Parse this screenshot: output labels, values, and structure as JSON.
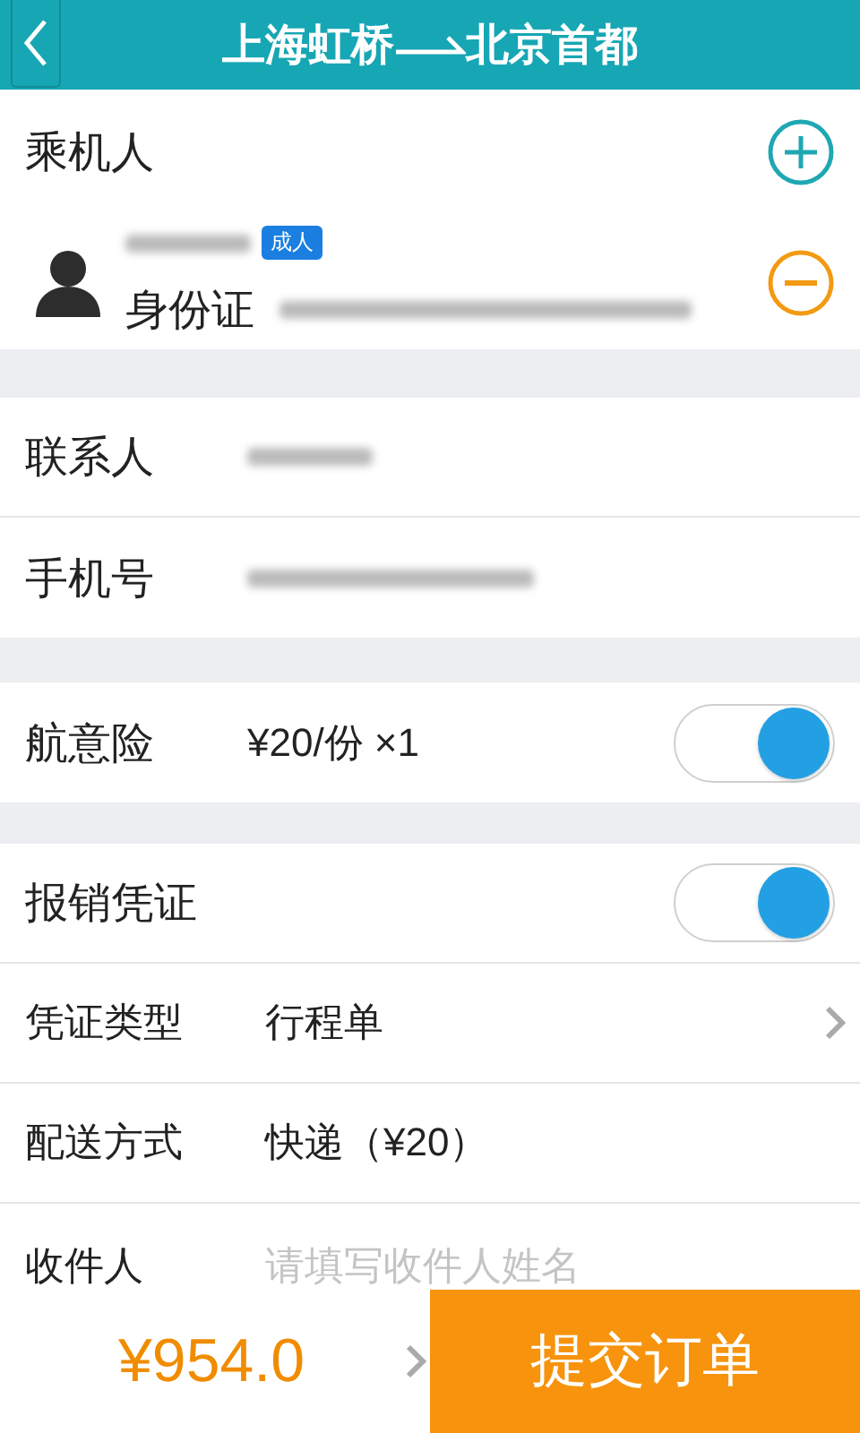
{
  "header": {
    "origin": "上海虹桥",
    "destination": "北京首都"
  },
  "passengers": {
    "title": "乘机人",
    "items": [
      {
        "type_badge": "成人",
        "id_label": "身份证"
      }
    ]
  },
  "contact": [
    {
      "label": "联系人"
    },
    {
      "label": "手机号"
    }
  ],
  "insurance": {
    "label": "航意险",
    "value": "¥20/份 ×1",
    "on": true
  },
  "invoice": {
    "label": "报销凭证",
    "on": true,
    "rows": [
      {
        "kind": "select",
        "label": "凭证类型",
        "value": "行程单"
      },
      {
        "kind": "text",
        "label": "配送方式",
        "value": "快递（¥20）"
      },
      {
        "kind": "input",
        "label": "收件人",
        "placeholder": "请填写收件人姓名"
      }
    ]
  },
  "footer": {
    "price": "¥954.0",
    "submit": "提交订单"
  }
}
